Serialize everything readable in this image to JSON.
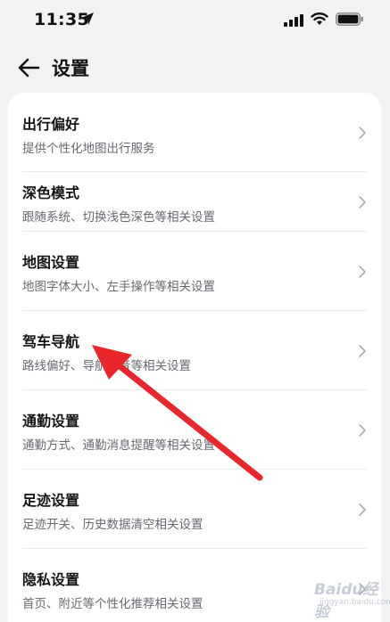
{
  "status": {
    "time": "11:35"
  },
  "header": {
    "title": "设置"
  },
  "settings": [
    {
      "title": "出行偏好",
      "subtitle": "提供个性化地图出行服务"
    },
    {
      "title": "深色模式",
      "subtitle": "跟随系统、切换浅色深色等相关设置"
    },
    {
      "title": "地图设置",
      "subtitle": "地图字体大小、左手操作等相关设置"
    },
    {
      "title": "驾车导航",
      "subtitle": "路线偏好、导航语音等相关设置"
    },
    {
      "title": "通勤设置",
      "subtitle": "通勤方式、通勤消息提醒等相关设置"
    },
    {
      "title": "足迹设置",
      "subtitle": "足迹开关、历史数据清空相关设置"
    },
    {
      "title": "隐私设置",
      "subtitle": "首页、附近等个性化推荐相关设置"
    }
  ],
  "annotation": {
    "color": "#e8262b"
  },
  "watermark": {
    "text": "Baidu经验",
    "sub": "jingyan.baidu.com"
  }
}
